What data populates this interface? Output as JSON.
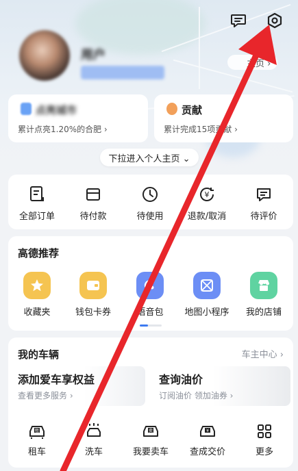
{
  "header": {
    "message_icon": "message-icon",
    "settings_icon": "settings-gear-icon"
  },
  "profile": {
    "username": "用户",
    "homepage_link": "主页 ›"
  },
  "stats": [
    {
      "title": "点亮城市",
      "subtitle": "累计点亮1.20%的合肥 ›",
      "color": "#6aa2f5"
    },
    {
      "title": "贡献",
      "subtitle": "累计完成15项贡献 ›",
      "color": "#f2a05a"
    }
  ],
  "pull_hint": "下拉进入个人主页 ⌄",
  "orders": [
    {
      "label": "全部订单",
      "icon": "all-orders-icon"
    },
    {
      "label": "待付款",
      "icon": "wallet-card-icon"
    },
    {
      "label": "待使用",
      "icon": "clock-icon"
    },
    {
      "label": "退款/取消",
      "icon": "refund-icon"
    },
    {
      "label": "待评价",
      "icon": "review-icon"
    }
  ],
  "recommend": {
    "title": "高德推荐",
    "items": [
      {
        "label": "收藏夹",
        "icon": "star-icon",
        "color": "#f5c451"
      },
      {
        "label": "钱包卡券",
        "icon": "wallet-icon",
        "color": "#f5c451"
      },
      {
        "label": "语音包",
        "icon": "voice-icon",
        "color": "#6c8ef5"
      },
      {
        "label": "地图小程序",
        "icon": "mini-program-icon",
        "color": "#6c8ef5"
      },
      {
        "label": "我的店铺",
        "icon": "shop-icon",
        "color": "#5fd3a1"
      }
    ]
  },
  "vehicles": {
    "title": "我的车辆",
    "center_link": "车主中心 ›",
    "promos": [
      {
        "title": "添加爱车享权益",
        "subtitle": "查看更多服务 ›"
      },
      {
        "title": "查询油价",
        "subtitle": "订阅油价 领加油券 ›"
      }
    ],
    "services": [
      {
        "label": "租车",
        "icon": "rent-car-icon"
      },
      {
        "label": "洗车",
        "icon": "car-wash-icon"
      },
      {
        "label": "我要卖车",
        "icon": "sell-car-icon"
      },
      {
        "label": "查成交价",
        "icon": "price-car-icon"
      },
      {
        "label": "更多",
        "icon": "more-grid-icon"
      }
    ]
  },
  "colors": {
    "accent": "#3d7af0",
    "arrow": "#e8262b"
  }
}
